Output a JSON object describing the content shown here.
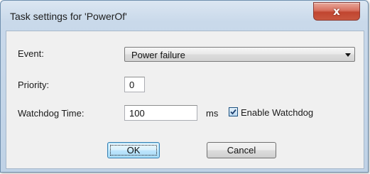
{
  "window": {
    "title": "Task settings for 'PowerOf'",
    "close_glyph": "x"
  },
  "form": {
    "event_label": "Event:",
    "event_value": "Power failure",
    "priority_label": "Priority:",
    "priority_value": "0",
    "watchdog_label": "Watchdog Time:",
    "watchdog_value": "100",
    "watchdog_unit": "ms",
    "enable_watchdog_label": "Enable Watchdog",
    "enable_watchdog_checked": true
  },
  "buttons": {
    "ok_label": "OK",
    "cancel_label": "Cancel"
  }
}
